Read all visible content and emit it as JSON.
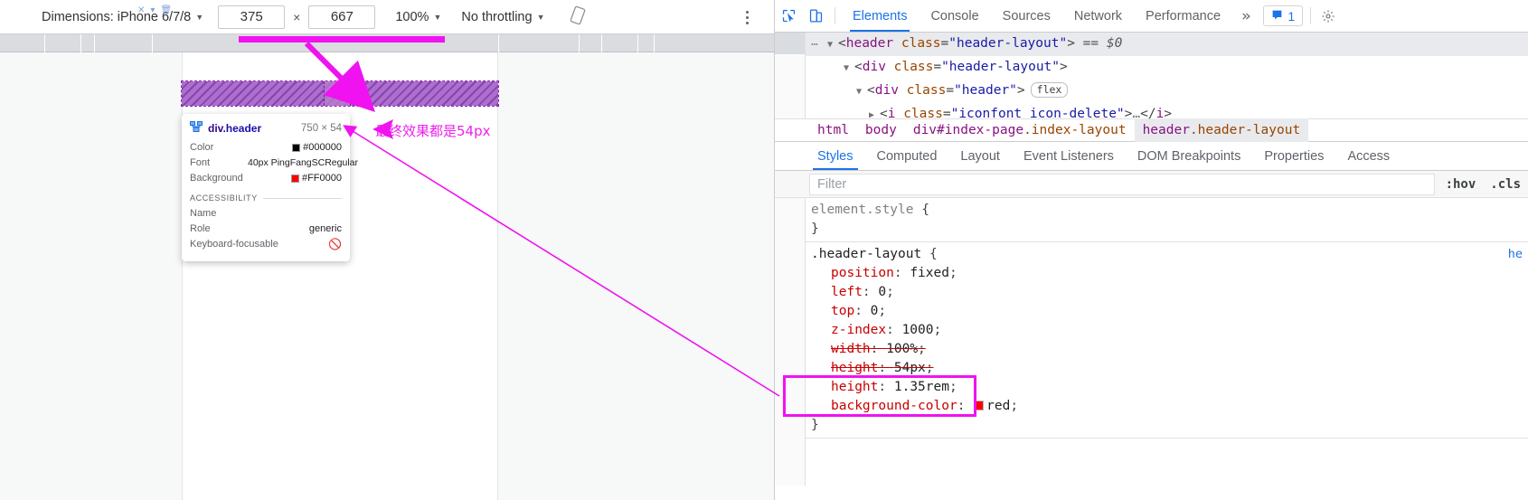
{
  "device_toolbar": {
    "dimensions_label": "Dimensions: iPhone 6/7/8",
    "width_value": "375",
    "times": "×",
    "height_value": "667",
    "zoom_label": "100%",
    "throttling_label": "No throttling",
    "rotate_icon": "rotate-icon",
    "menu_icon": "kebab-menu-icon",
    "caret": "▼"
  },
  "annotations": {
    "note_text": "最终效果都是54px",
    "accent_color": "#f012f0"
  },
  "element_tooltip": {
    "icon": "dom-node-icon",
    "tag_prefix": "div",
    "tag_class": ".header",
    "size": "750 × 54",
    "rows": [
      {
        "key": "Color",
        "swatch": "#000000",
        "value": "#000000"
      },
      {
        "key": "Font",
        "value": "40px PingFangSCRegular"
      },
      {
        "key": "Background",
        "swatch": "#FF0000",
        "value": "#FF0000"
      }
    ],
    "section_title": "ACCESSIBILITY",
    "a11y": [
      {
        "key": "Name",
        "value": ""
      },
      {
        "key": "Role",
        "value": "generic"
      },
      {
        "key": "Keyboard-focusable",
        "value": "not-focusable-icon"
      }
    ]
  },
  "devtools": {
    "inspect_icon": "inspect-element-icon",
    "device_toggle_icon": "device-toolbar-icon",
    "tabs": [
      {
        "label": "Elements",
        "active": true
      },
      {
        "label": "Console",
        "active": false
      },
      {
        "label": "Sources",
        "active": false
      },
      {
        "label": "Network",
        "active": false
      },
      {
        "label": "Performance",
        "active": false
      }
    ],
    "more_tabs_icon": "»",
    "issues": {
      "icon": "issues-icon",
      "count": "1"
    },
    "dom_tree": [
      {
        "indent": 0,
        "twisty": "▼",
        "selected": true,
        "tag": "header",
        "attr": "class",
        "value": "\"header-layout\"",
        "suffix": "== $0",
        "badge": "",
        "collapsed_children": false
      },
      {
        "indent": 1,
        "twisty": "▼",
        "selected": false,
        "tag": "div",
        "attr": "class",
        "value": "\"header-layout\"",
        "suffix": "",
        "badge": "",
        "collapsed_children": false
      },
      {
        "indent": 2,
        "twisty": "▼",
        "selected": false,
        "tag": "div",
        "attr": "class",
        "value": "\"header\"",
        "suffix": "",
        "badge": "flex",
        "collapsed_children": false
      },
      {
        "indent": 3,
        "twisty": "▶",
        "selected": false,
        "tag": "i",
        "attr": "class",
        "value": "\"iconfont icon-delete\"",
        "suffix": "",
        "badge": "",
        "collapsed_children": true
      }
    ],
    "breadcrumb": [
      {
        "text": "html",
        "cls": "",
        "selected": false
      },
      {
        "text": "body",
        "cls": "",
        "selected": false
      },
      {
        "text": "div#index-page",
        "cls": ".index-layout",
        "selected": false
      },
      {
        "text": "header",
        "cls": ".header-layout",
        "selected": true
      }
    ],
    "style_tabs": [
      {
        "label": "Styles",
        "active": true
      },
      {
        "label": "Computed",
        "active": false
      },
      {
        "label": "Layout",
        "active": false
      },
      {
        "label": "Event Listeners",
        "active": false
      },
      {
        "label": "DOM Breakpoints",
        "active": false
      },
      {
        "label": "Properties",
        "active": false
      },
      {
        "label": "Access",
        "active": false
      }
    ],
    "filter": {
      "placeholder": "Filter",
      "hov_label": ":hov",
      "cls_label": ".cls"
    },
    "css_rules": [
      {
        "selector": "element.style",
        "dim": true,
        "source": "",
        "declarations": []
      },
      {
        "selector": ".header-layout",
        "dim": false,
        "source": "he",
        "declarations": [
          {
            "prop": "position",
            "value": "fixed",
            "struck": false,
            "swatch": ""
          },
          {
            "prop": "left",
            "value": "0",
            "struck": false,
            "swatch": ""
          },
          {
            "prop": "top",
            "value": "0",
            "struck": false,
            "swatch": ""
          },
          {
            "prop": "z-index",
            "value": "1000",
            "struck": false,
            "swatch": ""
          },
          {
            "prop": "width",
            "value": "100%",
            "struck": true,
            "swatch": ""
          },
          {
            "prop": "height",
            "value": "54px",
            "struck": true,
            "swatch": ""
          },
          {
            "prop": "height",
            "value": "1.35rem",
            "struck": false,
            "swatch": ""
          },
          {
            "prop": "background-color",
            "value": "red",
            "struck": false,
            "swatch": "#ff0000"
          }
        ]
      }
    ]
  }
}
